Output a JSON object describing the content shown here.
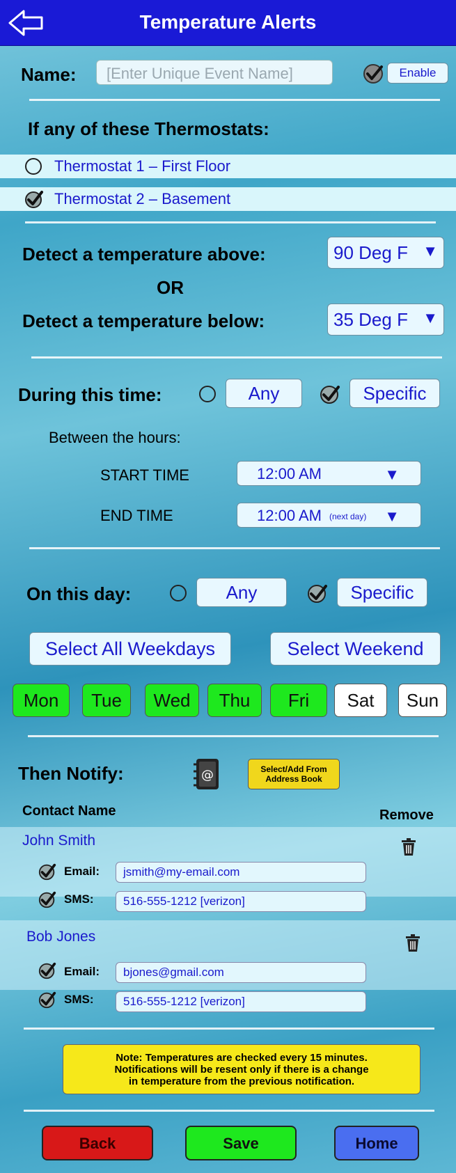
{
  "header": {
    "title": "Temperature Alerts"
  },
  "name_row": {
    "label": "Name:",
    "placeholder": "[Enter Unique Event Name]",
    "enable_label": "Enable"
  },
  "thermostats": {
    "heading": "If any of these Thermostats:",
    "items": [
      {
        "label": "Thermostat 1 – First Floor",
        "checked": false
      },
      {
        "label": "Thermostat 2 – Basement",
        "checked": true
      }
    ]
  },
  "detect": {
    "above_label": "Detect a temperature above:",
    "above_value": "90 Deg F",
    "or_label": "OR",
    "below_label": "Detect a temperature below:",
    "below_value": "35 Deg F"
  },
  "time": {
    "label": "During this time:",
    "any_label": "Any",
    "specific_label": "Specific",
    "between_label": "Between the hours:",
    "start_label": "START TIME",
    "start_value": "12:00 AM",
    "end_label": "END TIME",
    "end_value": "12:00 AM",
    "end_note": "(next day)"
  },
  "day": {
    "label": "On this day:",
    "any_label": "Any",
    "specific_label": "Specific",
    "select_weekdays": "Select All Weekdays",
    "select_weekend": "Select Weekend",
    "days": [
      {
        "label": "Mon",
        "on": true
      },
      {
        "label": "Tue",
        "on": true
      },
      {
        "label": "Wed",
        "on": true
      },
      {
        "label": "Thu",
        "on": true
      },
      {
        "label": "Fri",
        "on": true
      },
      {
        "label": "Sat",
        "on": false
      },
      {
        "label": "Sun",
        "on": false
      }
    ]
  },
  "notify": {
    "label": "Then Notify:",
    "address_book_button": "Select/Add From Address Book",
    "col_contact": "Contact Name",
    "col_remove": "Remove",
    "email_label": "Email:",
    "sms_label": "SMS:",
    "contacts": [
      {
        "name": "John Smith",
        "email": "jsmith@my-email.com",
        "sms": "516-555-1212 [verizon]"
      },
      {
        "name": "Bob Jones",
        "email": "bjones@gmail.com",
        "sms": "516-555-1212 [verizon]"
      }
    ]
  },
  "note": {
    "line1": "Note: Temperatures are checked every 15 minutes.",
    "line2": "Notifications will be resent only if there is a change",
    "line3": "in temperature from the previous notification."
  },
  "footer": {
    "back_label": "Back",
    "save_label": "Save",
    "home_label": "Home"
  },
  "colors": {
    "header": "#1a1ad6",
    "day_on": "#1ee81e",
    "back": "#d81818",
    "save": "#1ee81e",
    "home": "#4a6ef0",
    "note_bg": "#f6e81a"
  }
}
